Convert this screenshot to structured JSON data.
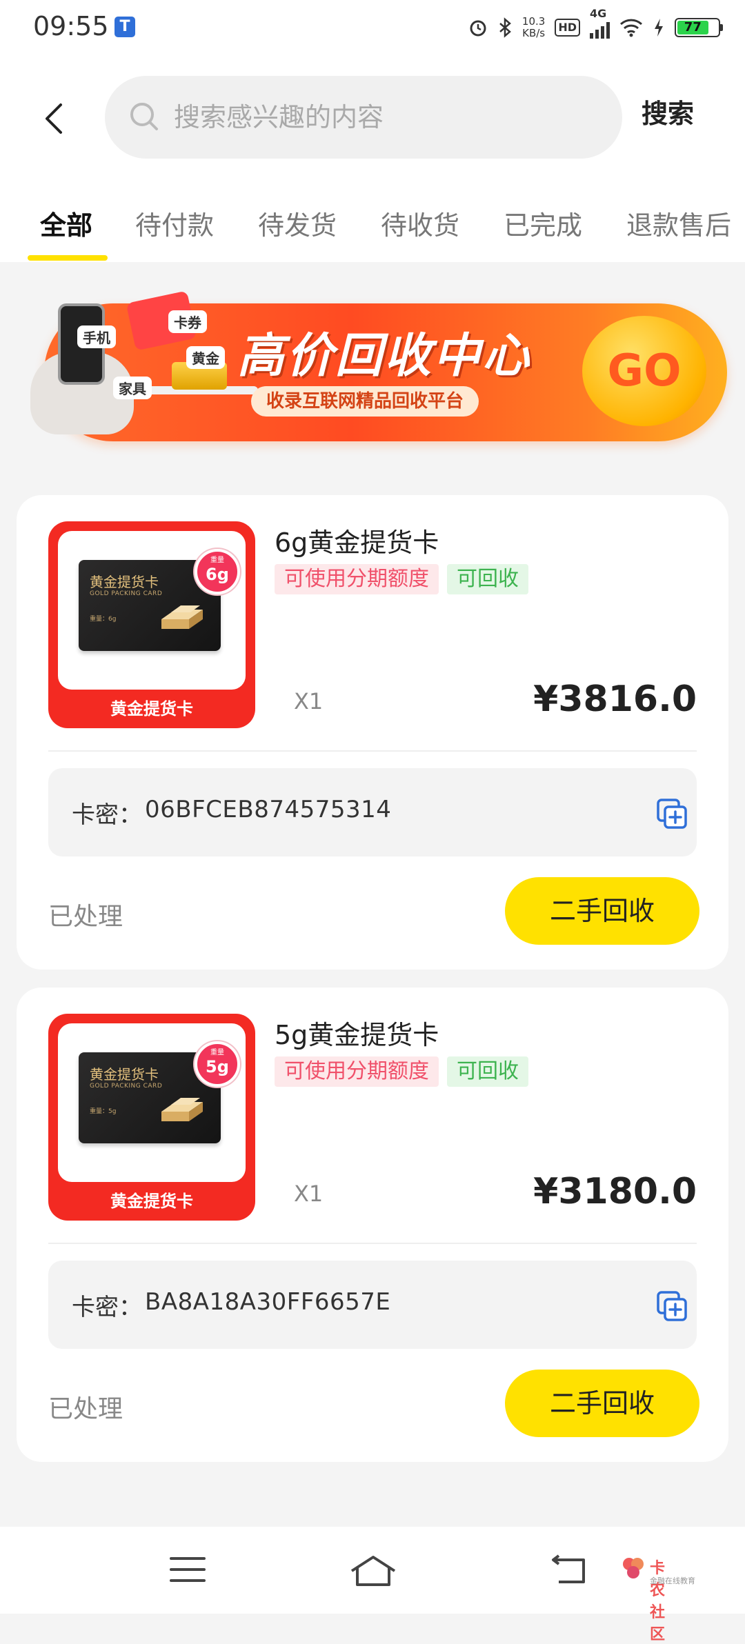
{
  "status_bar": {
    "time": "09:55",
    "app_icon": "T",
    "net_speed_value": "10.3",
    "net_speed_unit": "KB/s",
    "hd": "HD",
    "network": "4G",
    "battery": "77"
  },
  "header": {
    "search_placeholder": "搜索感兴趣的内容",
    "search_button": "搜索"
  },
  "tabs": [
    {
      "label": "全部",
      "active": true
    },
    {
      "label": "待付款"
    },
    {
      "label": "待发货"
    },
    {
      "label": "待收货"
    },
    {
      "label": "已完成"
    },
    {
      "label": "退款售后"
    }
  ],
  "banner": {
    "title": "高价回收中心",
    "subtitle": "收录互联网精品回收平台",
    "go": "GO",
    "labels": {
      "phone": "手机",
      "coupon": "卡券",
      "gold": "黄金",
      "furniture": "家具"
    }
  },
  "orders": [
    {
      "title": "6g黄金提货卡",
      "tag_installment": "可使用分期额度",
      "tag_recycle": "可回收",
      "card_title": "黄金提货卡",
      "card_en": "GOLD PACKING CARD",
      "card_weight_line": "重量：6g",
      "badge_label": "重量",
      "badge_weight": "6g",
      "thumb_caption": "黄金提货卡",
      "qty": "X1",
      "price": "¥3816.0",
      "key_label": "卡密：",
      "key_value": "06BFCEB874575314",
      "status": "已处理",
      "action": "二手回收"
    },
    {
      "title": "5g黄金提货卡",
      "tag_installment": "可使用分期额度",
      "tag_recycle": "可回收",
      "card_title": "黄金提货卡",
      "card_en": "GOLD PACKING CARD",
      "card_weight_line": "重量：5g",
      "badge_label": "重量",
      "badge_weight": "5g",
      "thumb_caption": "黄金提货卡",
      "qty": "X1",
      "price": "¥3180.0",
      "key_label": "卡密：",
      "key_value": "BA8A18A30FF6657E",
      "status": "已处理",
      "action": "二手回收"
    }
  ],
  "watermark": {
    "text": "卡农社区",
    "sub": "金融在线教育"
  }
}
